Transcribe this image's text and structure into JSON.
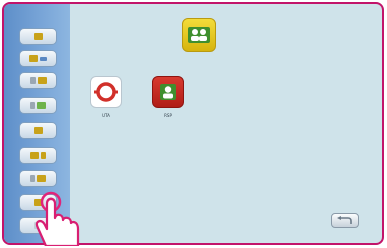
{
  "colors": {
    "frame": "#c2146a",
    "background": "#cfe3ea",
    "sidebar": "#6f9dd2",
    "accent_red": "#c72a24",
    "accent_green": "#4a9a36",
    "accent_yellow": "#e9c51c"
  },
  "sidebar": {
    "buttons": [
      {
        "icon": "single-unit-icon"
      },
      {
        "icon": "unit-with-cable-icon"
      },
      {
        "icon": "double-unit-icon"
      },
      {
        "icon": "unit-pair-icon"
      },
      {
        "icon": "single-unit-icon"
      },
      {
        "icon": "double-unit-icon"
      },
      {
        "icon": "unit-pair-icon"
      },
      {
        "icon": "single-unit-icon"
      },
      {
        "icon": "blank-icon"
      }
    ]
  },
  "top_tile": {
    "icon": "two-people-icon"
  },
  "tiles": [
    {
      "label": "UTA",
      "icon": "lifebuoy-icon"
    },
    {
      "label": "RSP",
      "icon": "person-icon"
    }
  ],
  "back_button": {
    "icon": "return-arrow-icon"
  },
  "pointer": {
    "icon": "hand-pointer-icon"
  }
}
